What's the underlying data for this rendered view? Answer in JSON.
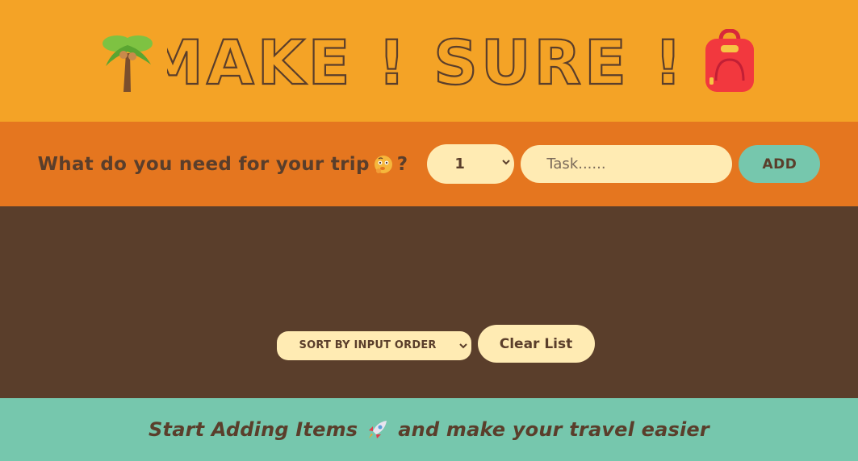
{
  "header": {
    "title": "MAKE ! SURE !!",
    "left_icon": "palm-tree-icon",
    "right_icon": "backpack-icon"
  },
  "form": {
    "question": "What do you need for your trip",
    "question_suffix": "?",
    "quantity_value": "1",
    "task_placeholder": "Task......",
    "add_label": "ADD"
  },
  "list": {
    "sort_value": "SORT BY INPUT ORDER",
    "clear_label": "Clear List"
  },
  "footer": {
    "text_before": "Start Adding Items",
    "text_after": "and make your travel easier"
  },
  "colors": {
    "header_bg": "#f4a326",
    "form_bg": "#e5761f",
    "list_bg": "#5a3e2b",
    "footer_bg": "#76c7ad",
    "input_bg": "#ffebb3"
  }
}
